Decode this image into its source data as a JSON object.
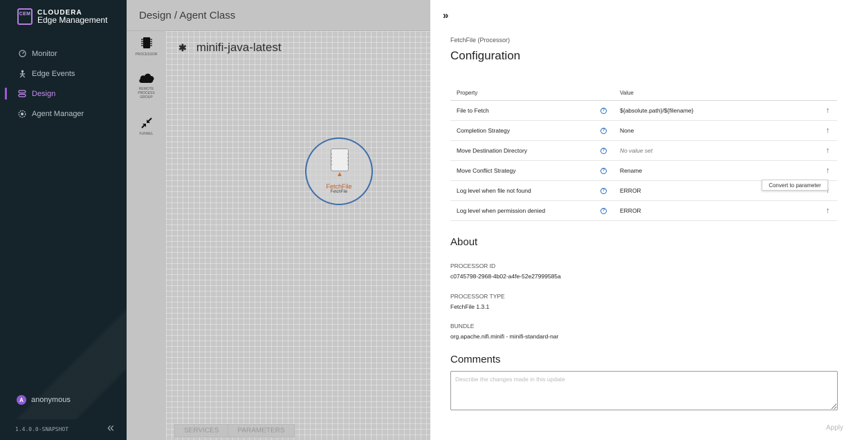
{
  "brand": {
    "logo": "CEM",
    "name": "CLOUDERA",
    "sub": "Edge Management"
  },
  "nav": [
    {
      "label": "Monitor",
      "icon": "gauge-icon",
      "active": false
    },
    {
      "label": "Edge Events",
      "icon": "person-icon",
      "active": false
    },
    {
      "label": "Design",
      "icon": "flow-icon",
      "active": true
    },
    {
      "label": "Agent Manager",
      "icon": "gear-icon",
      "active": false
    }
  ],
  "user": {
    "initial": "A",
    "name": "anonymous"
  },
  "version": "1.4.0.0-SNAPSHOT",
  "header": {
    "title": "Design / Agent Class"
  },
  "toolbox": {
    "processor": "PROCESSOR",
    "rpg": "REMOTE PROCESS GROUP",
    "funnel": "FUNNEL"
  },
  "flow": {
    "name": "minifi-java-latest"
  },
  "processor_node": {
    "name": "FetchFile",
    "type": "FetchFile"
  },
  "bottom_tabs": {
    "services": "SERVICES",
    "parameters": "PARAMETERS"
  },
  "panel": {
    "type_label": "FetchFile (Processor)",
    "title": "Configuration",
    "columns": {
      "property": "Property",
      "value": "Value"
    },
    "rows": [
      {
        "property": "File to Fetch",
        "value": "${absolute.path}/${filename}"
      },
      {
        "property": "Completion Strategy",
        "value": "None"
      },
      {
        "property": "Move Destination Directory",
        "value": "No value set"
      },
      {
        "property": "Move Conflict Strategy",
        "value": "Rename"
      },
      {
        "property": "Log level when file not found",
        "value": "ERROR"
      },
      {
        "property": "Log level when permission denied",
        "value": "ERROR"
      }
    ],
    "tooltip": "Convert to parameter",
    "about": {
      "title": "About",
      "processor_id_label": "PROCESSOR ID",
      "processor_id": "c0745798-2968-4b02-a4fe-52e27999585a",
      "processor_type_label": "PROCESSOR TYPE",
      "processor_type": "FetchFile 1.3.1",
      "bundle_label": "BUNDLE",
      "bundle": "org.apache.nifi.minifi - minifi-standard-nar"
    },
    "comments": {
      "title": "Comments",
      "placeholder": "Describe the changes made in this update"
    },
    "apply_label": "Apply"
  },
  "colors": {
    "accent": "#9c5ad1",
    "link": "#2b6db5",
    "sidebar": "#15242a",
    "warning": "#d0722e"
  }
}
